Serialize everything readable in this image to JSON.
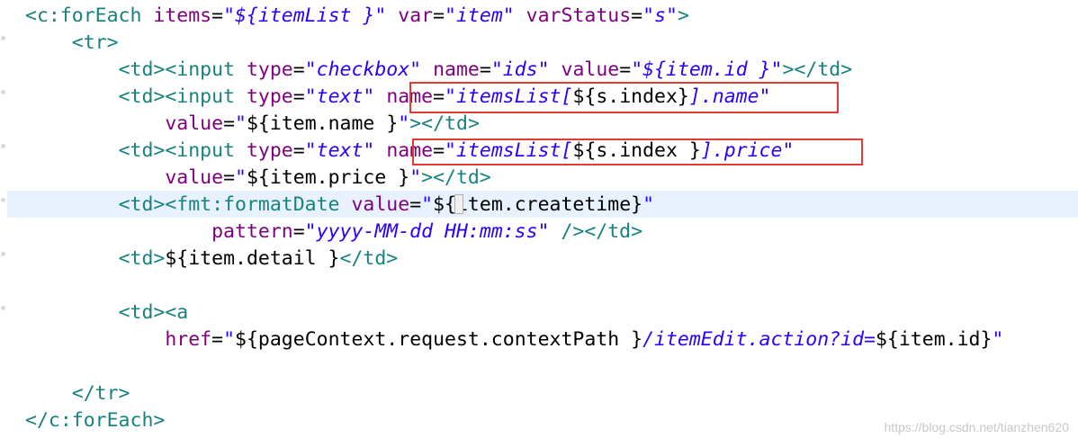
{
  "colors": {
    "tag": "#17827e",
    "attribute": "#7f007f",
    "string": "#2a00ff",
    "highlight_box": "#e53935",
    "current_line": "#e8f2fe"
  },
  "code_lines": [
    [
      [
        "tag",
        "<c:forEach "
      ],
      [
        "attr",
        "items"
      ],
      [
        "plain",
        "="
      ],
      [
        "str",
        "\"${itemList }\""
      ],
      [
        "plain",
        " "
      ],
      [
        "attr",
        "var"
      ],
      [
        "plain",
        "="
      ],
      [
        "str",
        "\"item\""
      ],
      [
        "plain",
        " "
      ],
      [
        "attr",
        "varStatus"
      ],
      [
        "plain",
        "="
      ],
      [
        "str",
        "\"s\""
      ],
      [
        "tag",
        ">"
      ]
    ],
    [
      [
        "plain",
        "    "
      ],
      [
        "tag",
        "<tr>"
      ]
    ],
    [
      [
        "plain",
        "        "
      ],
      [
        "tag",
        "<td><input "
      ],
      [
        "attr",
        "type"
      ],
      [
        "plain",
        "="
      ],
      [
        "str",
        "\"checkbox\""
      ],
      [
        "plain",
        " "
      ],
      [
        "attr",
        "name"
      ],
      [
        "plain",
        "="
      ],
      [
        "str",
        "\"ids\""
      ],
      [
        "plain",
        " "
      ],
      [
        "attr",
        "value"
      ],
      [
        "plain",
        "="
      ],
      [
        "str",
        "\"${item.id }\""
      ],
      [
        "tag",
        "></td>"
      ]
    ],
    [
      [
        "plain",
        "        "
      ],
      [
        "tag",
        "<td><input "
      ],
      [
        "attr",
        "type"
      ],
      [
        "plain",
        "="
      ],
      [
        "str",
        "\"text\""
      ],
      [
        "plain",
        " "
      ],
      [
        "attr",
        "name"
      ],
      [
        "plain",
        "="
      ],
      [
        "str",
        "\"itemsList["
      ],
      [
        "plain",
        "${s.index}"
      ],
      [
        "str",
        "].name\""
      ]
    ],
    [
      [
        "plain",
        "            "
      ],
      [
        "attr",
        "value"
      ],
      [
        "plain",
        "="
      ],
      [
        "str",
        "\""
      ],
      [
        "plain",
        "${item.name }"
      ],
      [
        "str",
        "\""
      ],
      [
        "tag",
        "></td>"
      ]
    ],
    [
      [
        "plain",
        "        "
      ],
      [
        "tag",
        "<td><input "
      ],
      [
        "attr",
        "type"
      ],
      [
        "plain",
        "="
      ],
      [
        "str",
        "\"text\""
      ],
      [
        "plain",
        " "
      ],
      [
        "attr",
        "name"
      ],
      [
        "plain",
        "="
      ],
      [
        "str",
        "\"itemsList["
      ],
      [
        "plain",
        "${s.index }"
      ],
      [
        "str",
        "].price\""
      ]
    ],
    [
      [
        "plain",
        "            "
      ],
      [
        "attr",
        "value"
      ],
      [
        "plain",
        "="
      ],
      [
        "str",
        "\""
      ],
      [
        "plain",
        "${item.price }"
      ],
      [
        "str",
        "\""
      ],
      [
        "tag",
        "></td>"
      ]
    ],
    [
      [
        "plain",
        "        "
      ],
      [
        "tag",
        "<td><fmt:formatDate "
      ],
      [
        "attr",
        "value"
      ],
      [
        "plain",
        "="
      ],
      [
        "str",
        "\""
      ],
      [
        "plain",
        "${item.createtime}"
      ],
      [
        "str",
        "\""
      ]
    ],
    [
      [
        "plain",
        "                "
      ],
      [
        "attr",
        "pattern"
      ],
      [
        "plain",
        "="
      ],
      [
        "str",
        "\"yyyy-MM-dd HH:mm:ss\""
      ],
      [
        "plain",
        " "
      ],
      [
        "tag",
        "/></td>"
      ]
    ],
    [
      [
        "plain",
        "        "
      ],
      [
        "tag",
        "<td>"
      ],
      [
        "plain",
        "${item.detail }"
      ],
      [
        "tag",
        "</td>"
      ]
    ],
    [],
    [
      [
        "plain",
        "        "
      ],
      [
        "tag",
        "<td><a"
      ]
    ],
    [
      [
        "plain",
        "            "
      ],
      [
        "attr",
        "href"
      ],
      [
        "plain",
        "="
      ],
      [
        "str",
        "\""
      ],
      [
        "plain",
        "${pageContext.request.contextPath }"
      ],
      [
        "str",
        "/itemEdit.action?id="
      ],
      [
        "plain",
        "${item.id}"
      ],
      [
        "str",
        "\""
      ]
    ],
    [],
    [
      [
        "plain",
        "    "
      ],
      [
        "tag",
        "</tr>"
      ]
    ],
    [
      [
        "tag",
        "</c:forEach>"
      ]
    ]
  ],
  "watermark": "https://blog.csdn.net/tianzhen620"
}
